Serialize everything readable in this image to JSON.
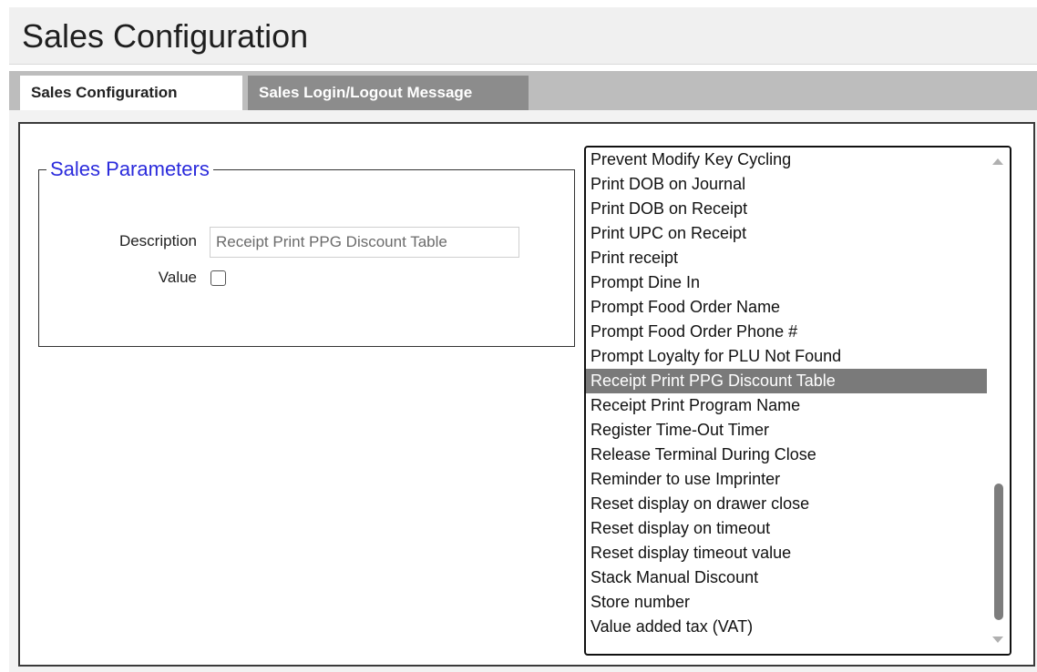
{
  "page": {
    "title": "Sales Configuration"
  },
  "tabs": [
    {
      "label": "Sales Configuration",
      "active": true
    },
    {
      "label": "Sales Login/Logout Message",
      "active": false
    }
  ],
  "sales_parameters": {
    "legend": "Sales Parameters",
    "description_label": "Description",
    "description_value": "Receipt Print PPG Discount Table",
    "value_label": "Value",
    "value_checked": false
  },
  "parameter_list": {
    "selected": "Receipt Print PPG Discount Table",
    "items": [
      "Prevent Modify Key Cycling",
      "Print DOB on Journal",
      "Print DOB on Receipt",
      "Print UPC on Receipt",
      "Print receipt",
      "Prompt Dine In",
      "Prompt Food Order Name",
      "Prompt Food Order Phone #",
      "Prompt Loyalty for PLU Not Found",
      "Receipt Print PPG Discount Table",
      "Receipt Print Program Name",
      "Register Time-Out Timer",
      "Release Terminal During Close",
      "Reminder to use Imprinter",
      "Reset display on drawer close",
      "Reset display on timeout",
      "Reset display timeout value",
      "Stack Manual Discount",
      "Store number",
      "Value added tax (VAT)"
    ]
  },
  "colors": {
    "legend_text": "#2b2bdc",
    "selected_row": "#7a7a7a",
    "tab_bar": "#bdbdbd",
    "inactive_tab": "#8c8c8c"
  },
  "icons": {
    "scroll_up": "scroll-up-arrow-icon",
    "scroll_down": "scroll-down-arrow-icon"
  }
}
